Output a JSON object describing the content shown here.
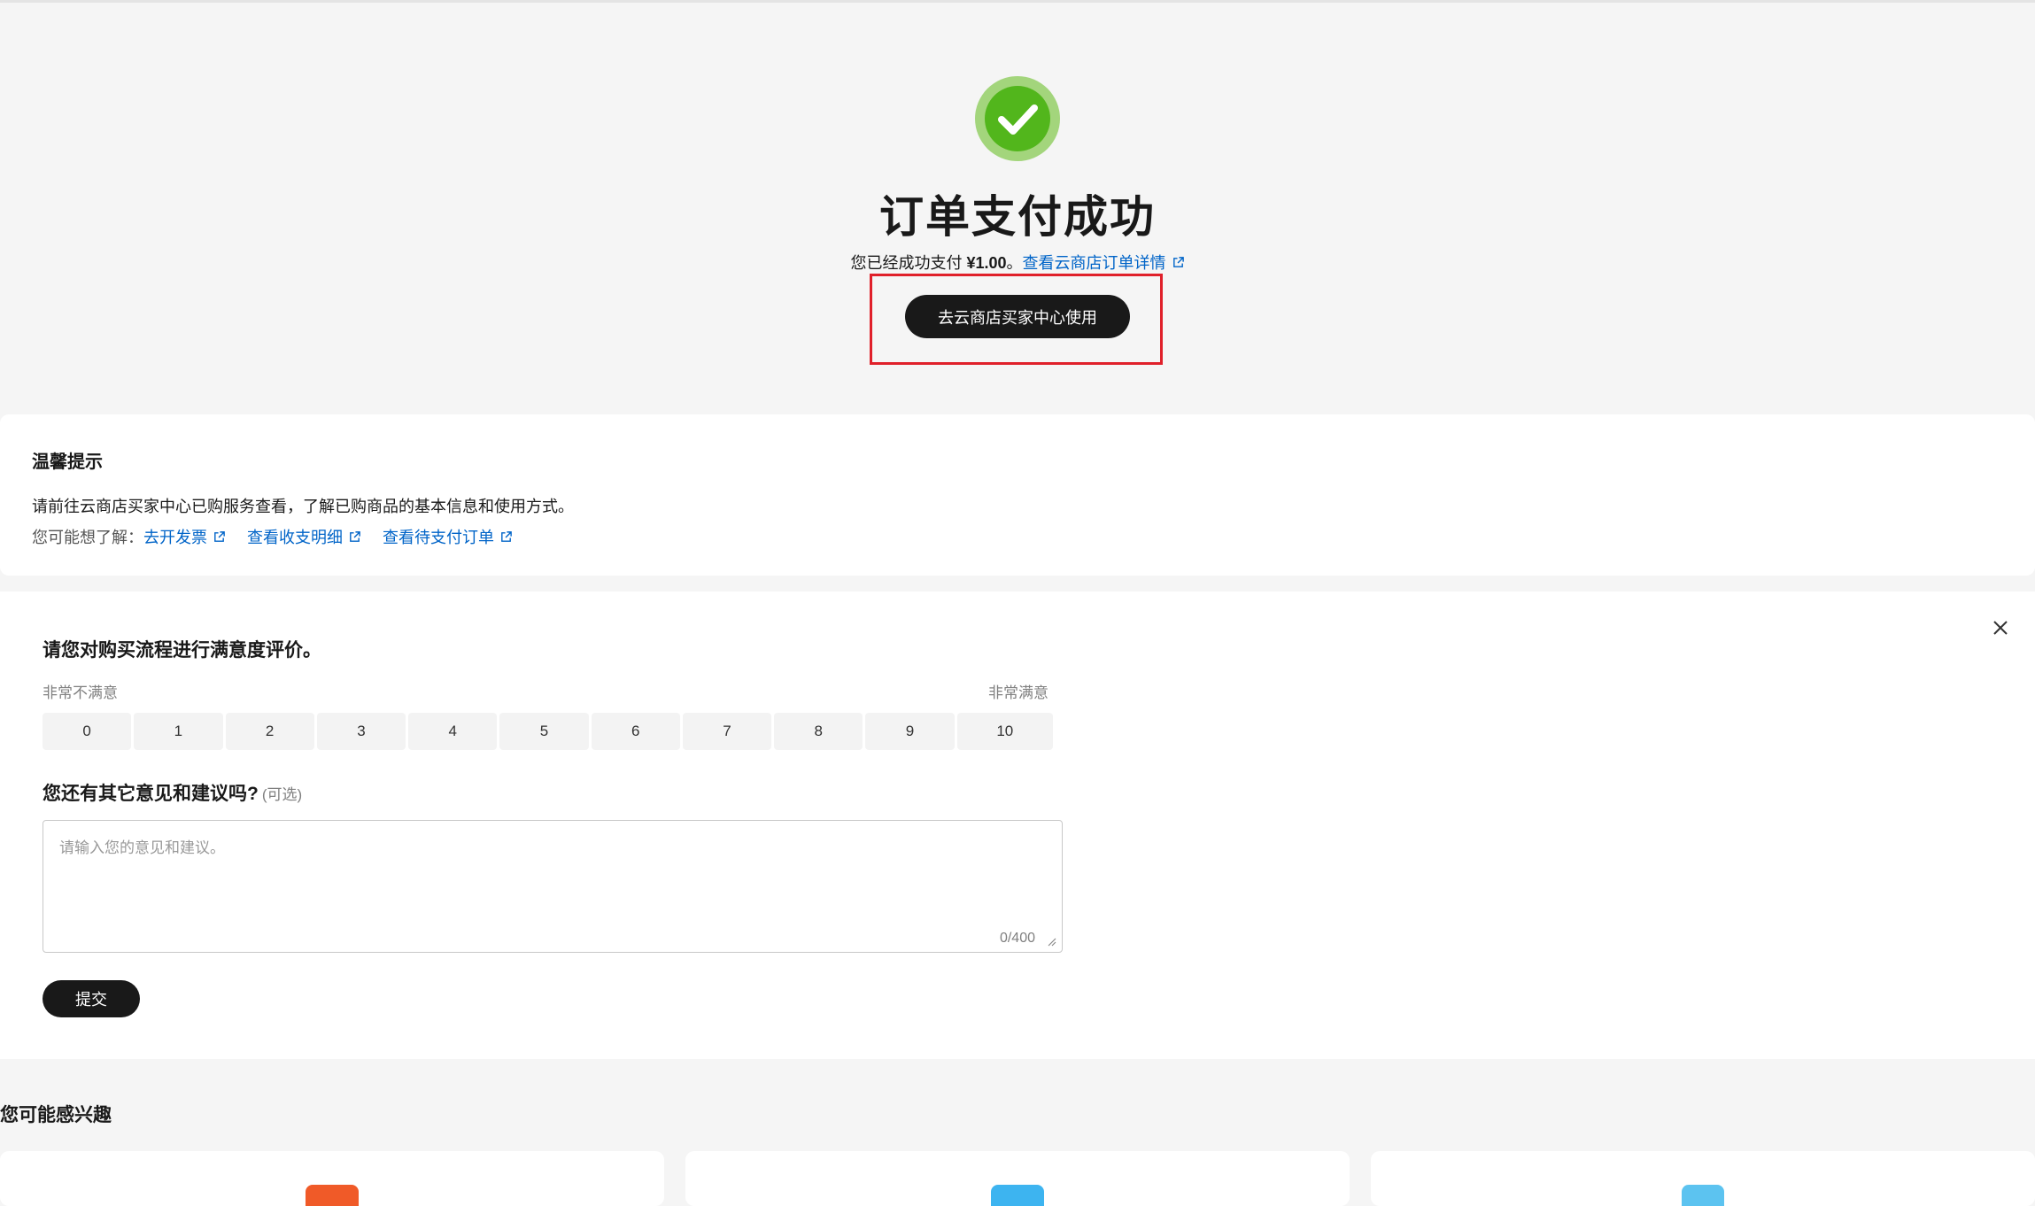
{
  "success": {
    "title": "订单支付成功",
    "desc_prefix": "您已经成功支付 ",
    "amount": "¥1.00",
    "desc_suffix": "。",
    "detail_link": "查看云商店订单详情",
    "primary_button": "去云商店买家中心使用"
  },
  "tips": {
    "title": "温馨提示",
    "text": "请前往云商店买家中心已购服务查看，了解已购商品的基本信息和使用方式。",
    "links_label": "您可能想了解：",
    "links": [
      "去开发票",
      "查看收支明细",
      "查看待支付订单"
    ]
  },
  "survey": {
    "question": "请您对购买流程进行满意度评价。",
    "low_label": "非常不满意",
    "high_label": "非常满意",
    "scale": [
      "0",
      "1",
      "2",
      "3",
      "4",
      "5",
      "6",
      "7",
      "8",
      "9",
      "10"
    ],
    "suggest_question": "您还有其它意见和建议吗?",
    "optional": "(可选)",
    "placeholder": "请输入您的意见和建议。",
    "char_count": "0/400",
    "submit": "提交"
  },
  "interests": {
    "title": "您可能感兴趣"
  },
  "colors": {
    "accent_link": "#0064c8",
    "success_green": "#52b61c",
    "primary_dark": "#191919",
    "highlight_red": "#e0202a",
    "product_icons": [
      "#f05a28",
      "#3db4f0",
      "#5cc3f0"
    ]
  },
  "icons": {
    "success": "check-circle-icon",
    "external": "external-link-icon",
    "close": "close-icon",
    "resize": "resize-handle-icon"
  }
}
